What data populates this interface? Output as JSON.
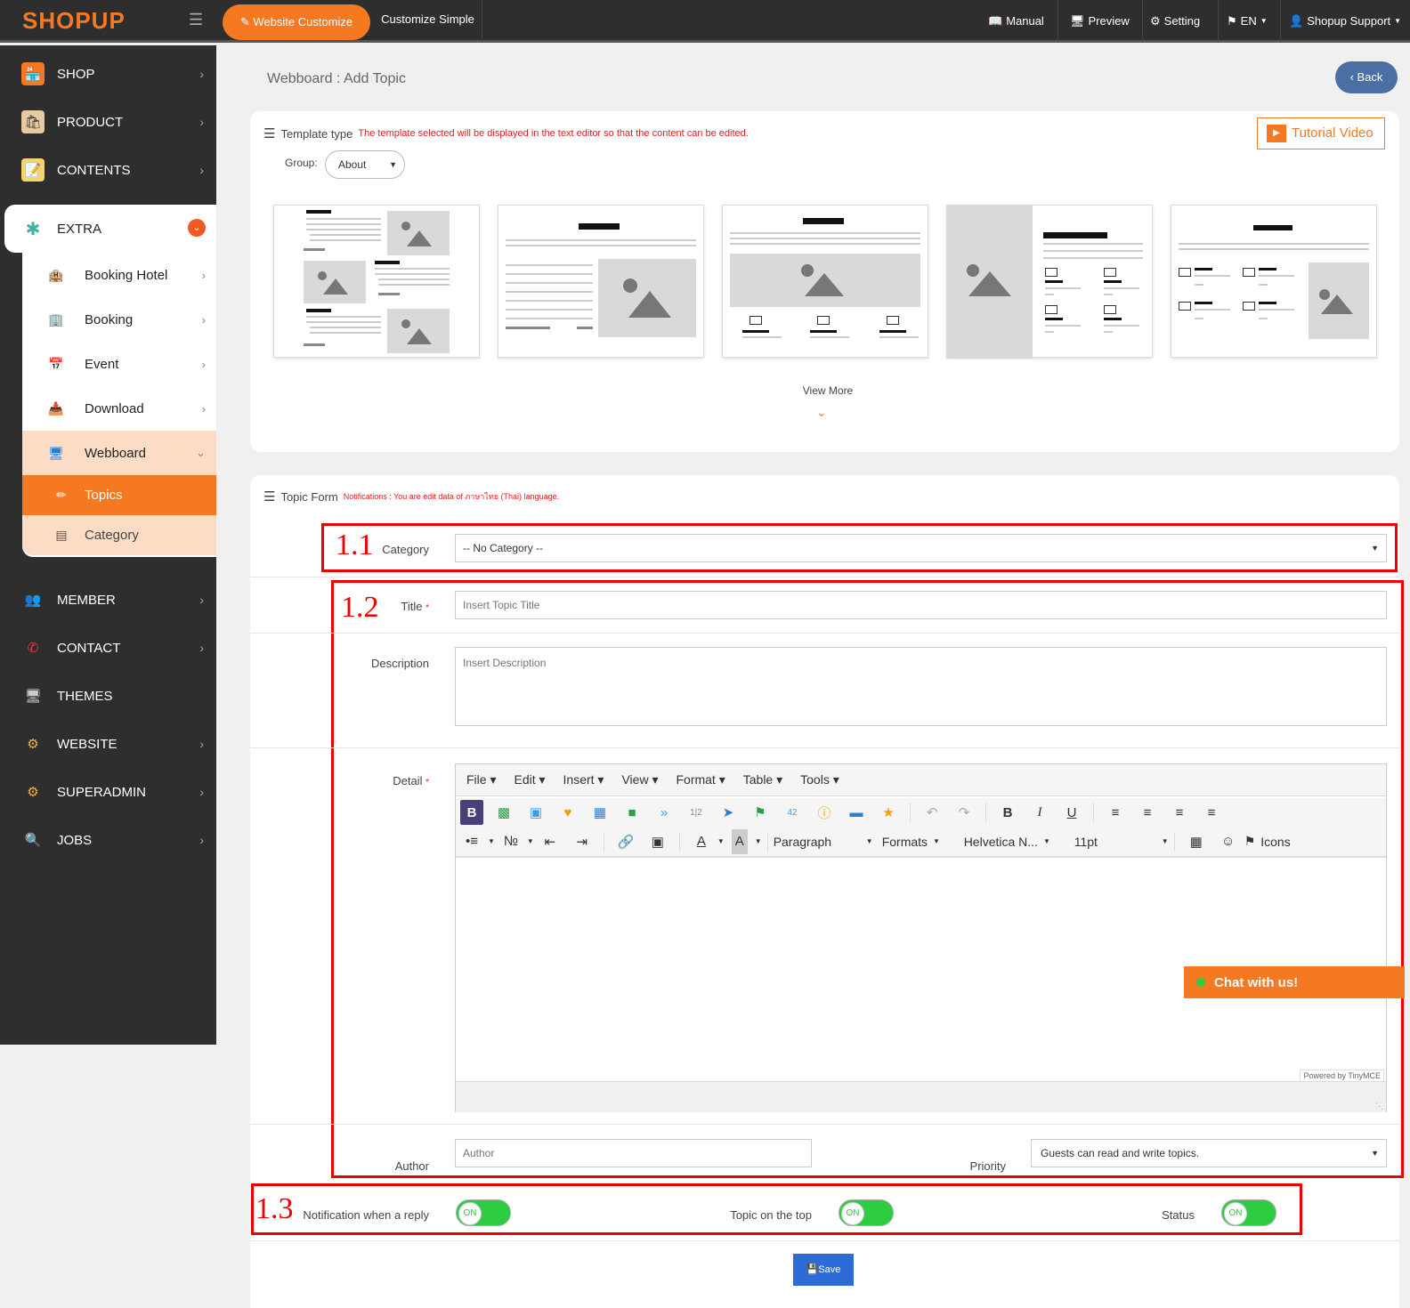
{
  "topbar": {
    "logo": "SHOPUP",
    "website_customize": "Website Customize",
    "customize_simple": "Customize Simple",
    "manual": "Manual",
    "preview": "Preview",
    "setting": "Setting",
    "language": "EN",
    "support": "Shopup Support"
  },
  "sidebar": {
    "shop": "SHOP",
    "product": "PRODUCT",
    "contents": "CONTENTS",
    "extra": "EXTRA",
    "sub": {
      "booking_hotel": "Booking Hotel",
      "booking": "Booking",
      "event": "Event",
      "download": "Download",
      "webboard": "Webboard",
      "topics": "Topics",
      "category": "Category"
    },
    "member": "MEMBER",
    "contact": "CONTACT",
    "themes": "THEMES",
    "website": "WEBSITE",
    "superadmin": "SUPERADMIN",
    "jobs": "JOBS"
  },
  "page": {
    "title": "Webboard : Add Topic",
    "back": "Back"
  },
  "template_panel": {
    "title": "Template type",
    "note": "The template selected will be displayed in the text editor so that the content can be edited.",
    "tutorial": "Tutorial Video",
    "group_label": "Group:",
    "group_value": "About",
    "view_more": "View More"
  },
  "form": {
    "title": "Topic Form",
    "notification": "Notifications : You are edit data of ภาษาไทย (Thai) language.",
    "category_label": "Category",
    "category_value": "-- No Category --",
    "title_label": "Title",
    "title_placeholder": "Insert Topic Title",
    "description_label": "Description",
    "description_placeholder": "Insert Description",
    "detail_label": "Detail",
    "author_label": "Author",
    "author_placeholder": "Author",
    "priority_label": "Priority",
    "priority_value": "Guests can read and write topics.",
    "notify_label": "Notification when a reply",
    "top_label": "Topic on the top",
    "status_label": "Status",
    "on": "ON",
    "save": "Save",
    "required": "*"
  },
  "annotations": {
    "a1": "1.1",
    "a2": "1.2",
    "a3": "1.3"
  },
  "editor": {
    "menus": [
      "File",
      "Edit",
      "Insert",
      "View",
      "Format",
      "Table",
      "Tools"
    ],
    "paragraph": "Paragraph",
    "formats": "Formats",
    "font": "Helvetica N...",
    "size": "11pt",
    "icons": "Icons",
    "powered": "Powered by TinyMCE"
  },
  "chat": {
    "label": "Chat with us!"
  },
  "colors": {
    "accent": "#f47920",
    "sidebar_bg": "#2e2e2e",
    "annotation": "#ee0000",
    "toggle_on": "#2ecc40",
    "save": "#2d6bd6"
  }
}
